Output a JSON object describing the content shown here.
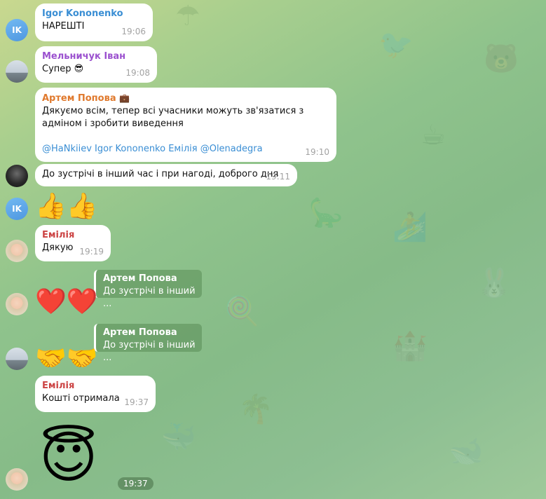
{
  "colors": {
    "igor": "#3a8ed4",
    "ivan": "#9b51cf",
    "artem": "#e07a2e",
    "emilia": "#cc4444",
    "link": "#3a8ed4"
  },
  "messages": {
    "m1": {
      "avatar_initials": "IK",
      "sender": "Igor Kononenko",
      "text": "НАРЕШТІ",
      "time": "19:06"
    },
    "m2": {
      "sender": "Мельничук Іван",
      "text": "Супер 😎",
      "time": "19:08"
    },
    "m3": {
      "sender": "Артем Попова",
      "sender_badge": "💼",
      "text": "Дякуємо всім, тепер всі учасники можуть зв'язатися з адміном і зробити виведення",
      "mentions": "@HaNkiiev Igor Kononenko Емілія @Olenadegra",
      "time": "19:10"
    },
    "m4": {
      "text": "До зустрічі в інший час і при нагоді, доброго дня",
      "time": "19:11"
    },
    "m5": {
      "avatar_initials": "IK",
      "emoji": "👍👍"
    },
    "m6": {
      "sender": "Емілія",
      "text": "Дякую",
      "time": "19:19"
    },
    "m7": {
      "reply_name": "Артем Попова",
      "reply_text": "До зустрічі в інший ...",
      "emoji": "❤️❤️"
    },
    "m8": {
      "reply_name": "Артем Попова",
      "reply_text": "До зустрічі в інший ...",
      "emoji": "🤝🤝"
    },
    "m9": {
      "sender": "Емілія",
      "text": "Кошті отримала",
      "time": "19:37"
    },
    "m10": {
      "emoji": "😇",
      "time": "19:37"
    }
  }
}
